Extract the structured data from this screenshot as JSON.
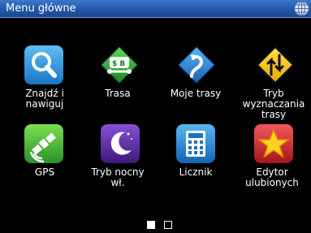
{
  "header": {
    "title": "Menu główne",
    "lang_icon": "globe-icon"
  },
  "menu": {
    "items": [
      {
        "label": "Znajdź i\nnawiguj",
        "icon": "search-icon"
      },
      {
        "label": "Trasa",
        "icon": "route-icon"
      },
      {
        "label": "Moje trasy",
        "icon": "my-routes-icon"
      },
      {
        "label": "Tryb\nwyznaczania\ntrasy",
        "icon": "route-mode-icon"
      },
      {
        "label": "GPS",
        "icon": "gps-satellite-icon"
      },
      {
        "label": "Tryb nocny\nwł.",
        "icon": "night-mode-icon"
      },
      {
        "label": "Licznik",
        "icon": "calculator-icon"
      },
      {
        "label": "Edytor\nulubionych",
        "icon": "star-icon"
      }
    ]
  },
  "pager": {
    "current_page": 1,
    "total_pages": 2
  },
  "colors": {
    "title_bar": "#2357a8",
    "background": "#000000",
    "search_tile": "#2a8fd6",
    "route_tile": "#27a33a",
    "my_routes_tile": "#2478c8",
    "route_mode_tile": "#f2c400",
    "gps_tile": "#3db33a",
    "night_tile": "#5a2aa0",
    "calculator_tile": "#1f86d4",
    "favorites_tile": "#d8242a"
  }
}
